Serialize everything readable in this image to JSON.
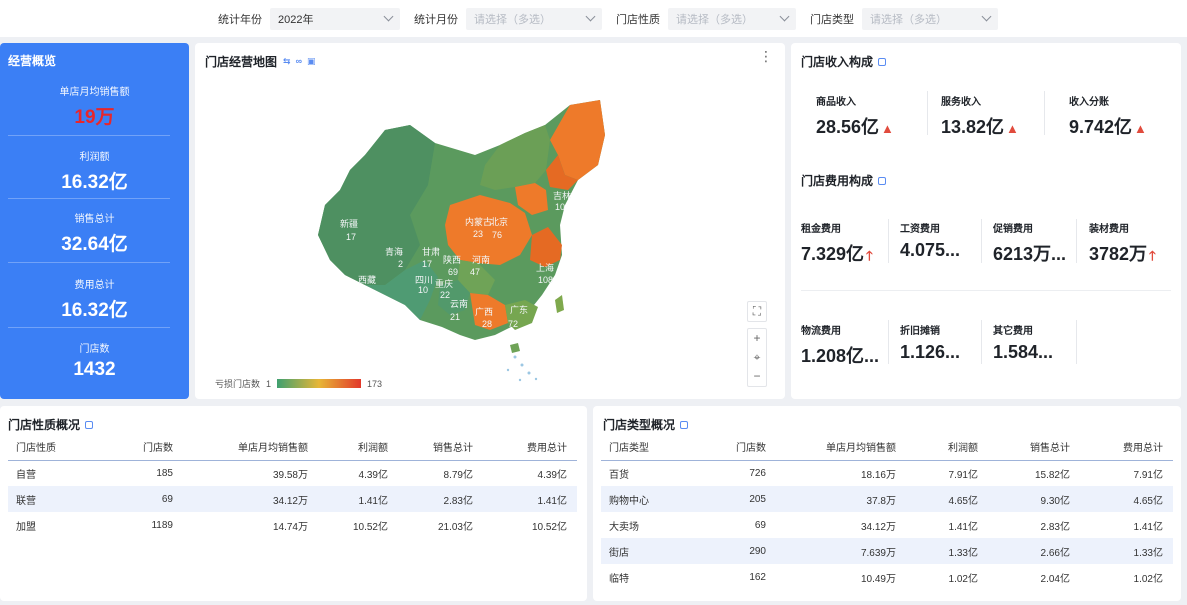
{
  "filters": [
    {
      "label": "统计年份",
      "value": "2022年",
      "placeholder": ""
    },
    {
      "label": "统计月份",
      "value": "",
      "placeholder": "请选择（多选）"
    },
    {
      "label": "门店性质",
      "value": "",
      "placeholder": "请选择（多选）"
    },
    {
      "label": "门店类型",
      "value": "",
      "placeholder": "请选择（多选）"
    }
  ],
  "overview": {
    "title": "经营概览",
    "items": [
      {
        "label": "单店月均销售额",
        "value": "19万"
      },
      {
        "label": "利润额",
        "value": "16.32亿"
      },
      {
        "label": "销售总计",
        "value": "32.64亿"
      },
      {
        "label": "费用总计",
        "value": "16.32亿"
      },
      {
        "label": "门店数",
        "value": "1432"
      }
    ]
  },
  "map": {
    "title": "门店经营地图",
    "legend": {
      "label": "亏损门店数",
      "min": "1",
      "max": "173"
    },
    "regions": [
      {
        "name": "新疆",
        "value": "17"
      },
      {
        "name": "西藏",
        "value": ""
      },
      {
        "name": "青海",
        "value": "2"
      },
      {
        "name": "甘肃",
        "value": "17"
      },
      {
        "name": "四川",
        "value": "10"
      },
      {
        "name": "重庆",
        "value": "22"
      },
      {
        "name": "陕西",
        "value": "69"
      },
      {
        "name": "内蒙古",
        "value": "23"
      },
      {
        "name": "北京",
        "value": "76"
      },
      {
        "name": "河南",
        "value": "47"
      },
      {
        "name": "吉林",
        "value": "10"
      },
      {
        "name": "上海",
        "value": "108"
      },
      {
        "name": "云南",
        "value": "21"
      },
      {
        "name": "广西",
        "value": "28"
      },
      {
        "name": "广东",
        "value": "72"
      }
    ],
    "colors": {
      "low": "#3fa070",
      "mid": "#e7b637",
      "high": "#e2382b",
      "orange": "#ee7a2a"
    }
  },
  "income": {
    "title": "门店收入构成",
    "items": [
      {
        "label": "商品收入",
        "value": "28.56亿",
        "trend": "▲"
      },
      {
        "label": "服务收入",
        "value": "13.82亿",
        "trend": "▲"
      },
      {
        "label": "收入分账",
        "value": "9.742亿",
        "trend": "▲"
      }
    ]
  },
  "expense": {
    "title": "门店费用构成",
    "items": [
      {
        "label": "租金费用",
        "value": "7.329亿",
        "trend": "🡑"
      },
      {
        "label": "工资费用",
        "value": "4.075...",
        "trend": ""
      },
      {
        "label": "促销费用",
        "value": "6213万...",
        "trend": ""
      },
      {
        "label": "装材费用",
        "value": "3782万",
        "trend": "🡑"
      },
      {
        "label": "物流费用",
        "value": "1.208亿...",
        "trend": ""
      },
      {
        "label": "折旧摊销",
        "value": "1.126...",
        "trend": ""
      },
      {
        "label": "其它费用",
        "value": "1.584...",
        "trend": ""
      }
    ]
  },
  "nature_table": {
    "title": "门店性质概况",
    "headers": [
      "门店性质",
      "门店数",
      "单店月均销售额",
      "利润额",
      "销售总计",
      "费用总计"
    ],
    "rows": [
      [
        "自营",
        "185",
        "39.58万",
        "4.39亿",
        "8.79亿",
        "4.39亿"
      ],
      [
        "联营",
        "69",
        "34.12万",
        "1.41亿",
        "2.83亿",
        "1.41亿"
      ],
      [
        "加盟",
        "1189",
        "14.74万",
        "10.52亿",
        "21.03亿",
        "10.52亿"
      ]
    ]
  },
  "type_table": {
    "title": "门店类型概况",
    "headers": [
      "门店类型",
      "门店数",
      "单店月均销售额",
      "利润额",
      "销售总计",
      "费用总计"
    ],
    "rows": [
      [
        "百货",
        "726",
        "18.16万",
        "7.91亿",
        "15.82亿",
        "7.91亿"
      ],
      [
        "购物中心",
        "205",
        "37.8万",
        "4.65亿",
        "9.30亿",
        "4.65亿"
      ],
      [
        "大卖场",
        "69",
        "34.12万",
        "1.41亿",
        "2.83亿",
        "1.41亿"
      ],
      [
        "街店",
        "290",
        "7.639万",
        "1.33亿",
        "2.66亿",
        "1.33亿"
      ],
      [
        "临特",
        "162",
        "10.49万",
        "1.02亿",
        "2.04亿",
        "1.02亿"
      ]
    ]
  }
}
